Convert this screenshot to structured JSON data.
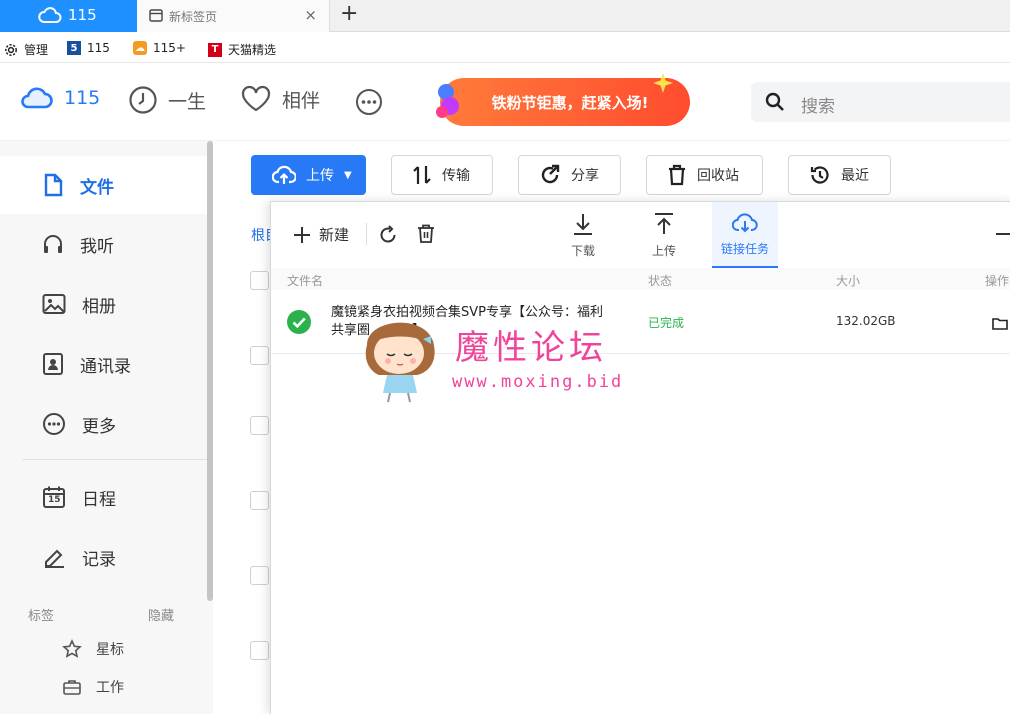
{
  "browser": {
    "tabs": [
      {
        "label": "115",
        "icon": "cloud-icon",
        "active": true
      },
      {
        "label": "新标签页",
        "icon": "window-icon",
        "active": false
      }
    ],
    "new_tab_symbol": "+",
    "close_symbol": "×",
    "bookmarks": [
      {
        "label": "管理",
        "icon": "gear-icon"
      },
      {
        "label": "115",
        "icon": "115-logo"
      },
      {
        "label": "115+",
        "icon": "115-plus-logo"
      },
      {
        "label": "天猫精选",
        "icon": "tmall-logo"
      }
    ]
  },
  "header": {
    "nav": [
      {
        "label": "115",
        "icon": "cloud-icon"
      },
      {
        "label": "一生",
        "icon": "clock-icon"
      },
      {
        "label": "相伴",
        "icon": "heart-icon"
      }
    ],
    "more_icon": "more-icon",
    "banner_text": "铁粉节钜惠，赶紧入场!",
    "search_placeholder": "搜索"
  },
  "sidebar": {
    "items": [
      {
        "label": "文件",
        "icon": "file-icon",
        "active": true
      },
      {
        "label": "我听",
        "icon": "headphones-icon"
      },
      {
        "label": "相册",
        "icon": "image-icon"
      },
      {
        "label": "通讯录",
        "icon": "contacts-icon"
      },
      {
        "label": "更多",
        "icon": "more-icon"
      },
      {
        "label": "日程",
        "icon": "calendar-icon",
        "calendar_day": "15"
      },
      {
        "label": "记录",
        "icon": "edit-icon"
      }
    ],
    "tags_label": "标签",
    "hide_label": "隐藏",
    "sub_items": [
      {
        "label": "星标",
        "icon": "star-icon"
      },
      {
        "label": "工作",
        "icon": "briefcase-icon"
      }
    ]
  },
  "toolbar": {
    "upload": "上传",
    "transfer": "传输",
    "share": "分享",
    "recycle": "回收站",
    "recent": "最近",
    "breadcrumb_root": "根目"
  },
  "transfer_panel": {
    "new_label": "新建",
    "tabs": [
      {
        "label": "下载",
        "icon": "download-icon"
      },
      {
        "label": "上传",
        "icon": "upload-icon"
      },
      {
        "label": "链接任务",
        "icon": "cloud-download-icon",
        "active": true
      }
    ],
    "columns": {
      "name": "文件名",
      "status": "状态",
      "size": "大小",
      "action": "操作"
    },
    "rows": [
      {
        "name_line1": "魔镜紧身衣拍视频合集SVP专享【公众号：福利",
        "name_line2": "共享圈",
        "name_tail": "】",
        "status": "已完成",
        "size": "132.02GB",
        "status_color": "#2bb24c"
      }
    ]
  },
  "watermark": {
    "title": "魔性论坛",
    "url": "www.moxing.bid"
  }
}
